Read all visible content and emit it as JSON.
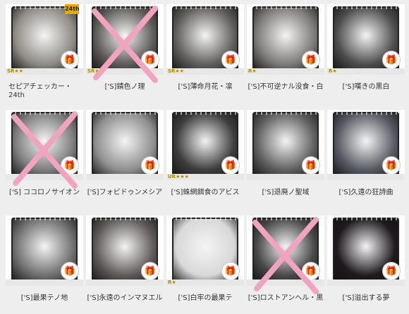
{
  "rows": [
    {
      "cards": [
        {
          "label": "セピアチェッカー・24th",
          "rarity": "SR★★",
          "ribbon": "24th",
          "crossed": false,
          "color": "#8f8c86",
          "align": "left"
        },
        {
          "label": "['S]錆色ノ理",
          "rarity": "SR★",
          "ribbon": "",
          "crossed": true,
          "color": "#5d5b58",
          "align": "center"
        },
        {
          "label": "['S]薄命月花・凛",
          "rarity": "SR★★",
          "ribbon": "",
          "crossed": false,
          "color": "#605f5c",
          "align": "center"
        },
        {
          "label": "['S]不可逆ナル没食・白",
          "rarity": "R★",
          "ribbon": "",
          "crossed": false,
          "color": "#7c7a77",
          "align": "center"
        },
        {
          "label": "['S]嘆きの黒白",
          "rarity": "R★",
          "ribbon": "",
          "crossed": false,
          "color": "#4d4d4d",
          "align": "center"
        }
      ]
    },
    {
      "cards": [
        {
          "label": "['S] ココロノサイオン",
          "rarity": "",
          "ribbon": "",
          "crossed": true,
          "color": "#7d7d7d",
          "align": "center"
        },
        {
          "label": "['S]フォビドゥンメシア",
          "rarity": "",
          "ribbon": "",
          "crossed": false,
          "color": "#8f8f8f",
          "align": "center"
        },
        {
          "label": "['S]蛛網餌食のアビス",
          "rarity": "UR★★★",
          "ribbon": "",
          "crossed": false,
          "color": "#3d3d3d",
          "align": "center"
        },
        {
          "label": "['S]退廃ノ聖域",
          "rarity": "",
          "ribbon": "",
          "crossed": false,
          "color": "#5f5f5f",
          "align": "center"
        },
        {
          "label": "['S]久遠の狂詩曲",
          "rarity": "",
          "ribbon": "",
          "crossed": false,
          "color": "#575962",
          "align": "center"
        }
      ]
    },
    {
      "cards": [
        {
          "label": "['S]最果テノ地",
          "rarity": "",
          "ribbon": "",
          "crossed": false,
          "color": "#6f6f6f",
          "align": "center"
        },
        {
          "label": "['S]永遠のインマヌエル",
          "rarity": "",
          "ribbon": "",
          "crossed": false,
          "color": "#5e5a58",
          "align": "center"
        },
        {
          "label": "['S]白牢の最果テ",
          "rarity": "R★",
          "ribbon": "",
          "crossed": false,
          "color": "#d8d8d8",
          "align": "center"
        },
        {
          "label": "['S]ロストアンヘル・黒",
          "rarity": "",
          "ribbon": "",
          "crossed": true,
          "color": "#474747",
          "align": "center"
        },
        {
          "label": "['S]溢出する夢",
          "rarity": "",
          "ribbon": "",
          "crossed": false,
          "color": "#1e1a1e",
          "align": "center"
        }
      ]
    }
  ],
  "colors": {
    "accent": "#f2a3c0",
    "background": "#efeeee"
  },
  "icons": {
    "gift": "gift-icon",
    "cross": "cross-mark"
  }
}
